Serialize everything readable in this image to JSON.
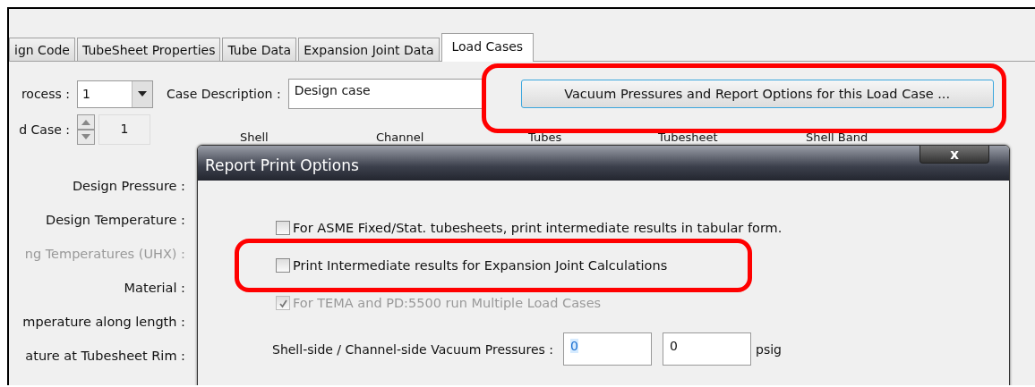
{
  "tabs": [
    {
      "label": "ign Code",
      "selected": false
    },
    {
      "label": "TubeSheet Properties",
      "selected": false
    },
    {
      "label": "Tube Data",
      "selected": false
    },
    {
      "label": "Expansion Joint Data",
      "selected": false
    },
    {
      "label": "Load Cases",
      "selected": true
    }
  ],
  "process": {
    "label": "rocess :",
    "value": "1"
  },
  "case_description": {
    "label": "Case Description :",
    "value": "Design case"
  },
  "options_button": {
    "label": "Vacuum Pressures and Report Options for this Load Case ...",
    "highlighted": true
  },
  "load_case": {
    "label": "d Case :",
    "value": "1"
  },
  "column_headers": [
    "Shell",
    "Channel",
    "Tubes",
    "Tubesheet",
    "Shell Band"
  ],
  "row_labels": [
    {
      "label": "Design Pressure :",
      "disabled": false
    },
    {
      "label": "Design Temperature :",
      "disabled": false
    },
    {
      "label": "ng Temperatures (UHX) :",
      "disabled": true
    },
    {
      "label": "Material :",
      "disabled": false
    },
    {
      "label": "mperature along length :",
      "disabled": false
    },
    {
      "label": "ature at Tubesheet Rim :",
      "disabled": false
    }
  ],
  "dialog": {
    "title": "Report Print Options",
    "close": "x",
    "options": [
      {
        "label": "For ASME Fixed/Stat. tubesheets, print intermediate results in tabular form.",
        "checked": false,
        "disabled": false,
        "highlighted": false
      },
      {
        "label": "Print Intermediate results for Expansion Joint Calculations",
        "checked": false,
        "disabled": false,
        "highlighted": true
      },
      {
        "label": "For TEMA and PD:5500 run Multiple Load Cases",
        "checked": true,
        "disabled": true,
        "highlighted": false
      }
    ],
    "vacuum": {
      "label": "Shell-side / Channel-side Vacuum Pressures :",
      "fields": [
        {
          "value": "0",
          "selected": true
        },
        {
          "value": "0",
          "selected": false
        }
      ],
      "unit": "psig"
    }
  }
}
